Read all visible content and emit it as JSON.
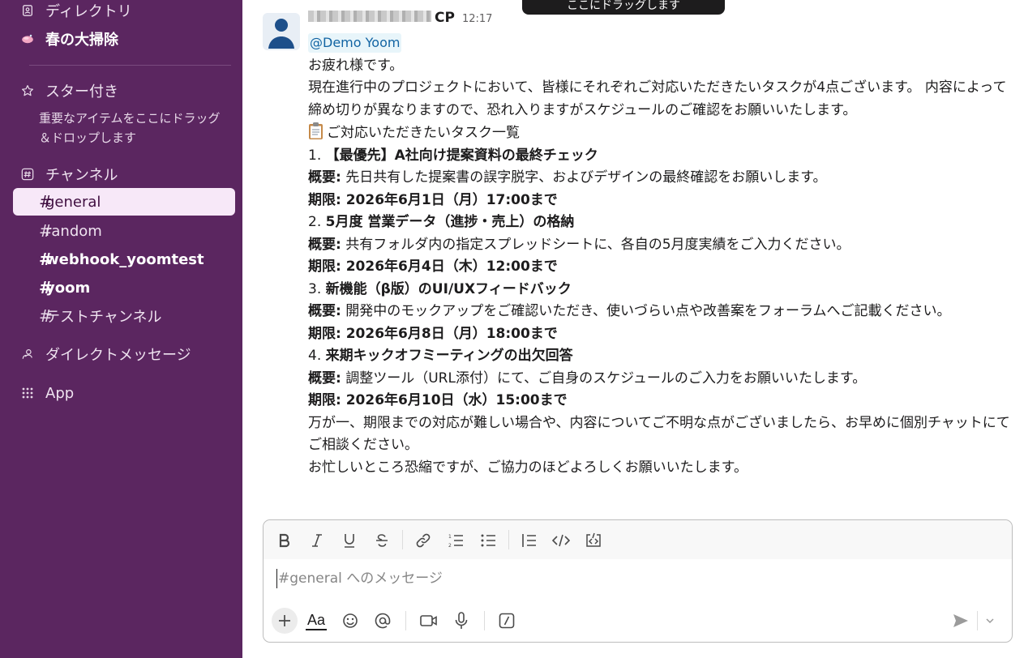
{
  "toast": {
    "text": "ここにドラッグします"
  },
  "sidebar": {
    "directory": "ディレクトリ",
    "spring_cleaning": "春の大掃除",
    "starred": "スター付き",
    "starred_hint": "重要なアイテムをここにドラッグ＆ドロップします",
    "channels_header": "チャンネル",
    "channels": [
      {
        "label": "general",
        "active": true
      },
      {
        "label": "random"
      },
      {
        "label": "webhook_yoomtest",
        "bold": true
      },
      {
        "label": "yoom",
        "bold": true
      },
      {
        "label": "テストチャンネル"
      }
    ],
    "dm_header": "ダイレクトメッセージ",
    "app": "App"
  },
  "message": {
    "author_suffix": "CP",
    "time": "12:17",
    "mention": "@Demo Yoom",
    "greeting": "お疲れ様です。",
    "intro": "現在進行中のプロジェクトにおいて、皆様にそれぞれご対応いただきたいタスクが4点ございます。 内容によって締め切りが異なりますので、恐れ入りますがスケジュールのご確認をお願いいたします。",
    "list_title": "ご対応いただきたいタスク一覧",
    "tasks": [
      {
        "num": "1.",
        "title": "【最優先】A社向け提案資料の最終チェック",
        "summary_label": "概要:",
        "summary": "先日共有した提案書の誤字脱字、およびデザインの最終確認をお願いします。",
        "deadline": "期限: 2026年6月1日（月）17:00まで"
      },
      {
        "num": "2.",
        "title": "5月度 営業データ（進捗・売上）の格納",
        "summary_label": "概要:",
        "summary": "共有フォルダ内の指定スプレッドシートに、各自の5月度実績をご入力ください。",
        "deadline": "期限: 2026年6月4日（木）12:00まで"
      },
      {
        "num": "3.",
        "title": "新機能（β版）のUI/UXフィードバック",
        "summary_label": "概要:",
        "summary": "開発中のモックアップをご確認いただき、使いづらい点や改善案をフォーラムへご記載ください。",
        "deadline": "期限: 2026年6月8日（月）18:00まで"
      },
      {
        "num": "4.",
        "title": "来期キックオフミーティングの出欠回答",
        "summary_label": "概要:",
        "summary": "調整ツール（URL添付）にて、ご自身のスケジュールのご入力をお願いいたします。",
        "deadline": "期限: 2026年6月10日（水）15:00まで"
      }
    ],
    "closing1": "万が一、期限までの対応が難しい場合や、内容についてご不明な点がございましたら、お早めに個別チャットにてご相談ください。",
    "closing2": "お忙しいところ恐縮ですが、ご協力のほどよろしくお願いいたします。"
  },
  "composer": {
    "placeholder": "#general へのメッセージ",
    "format_label": "Aa"
  }
}
